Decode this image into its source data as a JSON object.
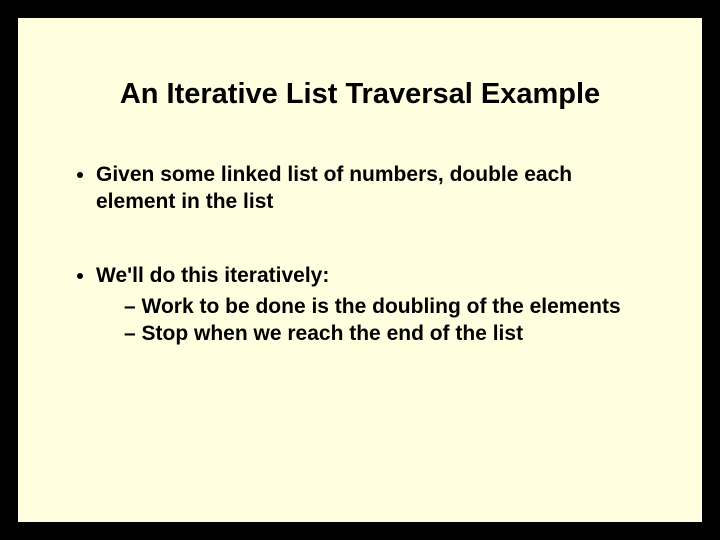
{
  "slide": {
    "title": "An Iterative List Traversal Example",
    "bullets": [
      {
        "text": "Given some linked list of numbers, double each element in the list"
      },
      {
        "text": "We'll do this iteratively:",
        "sub": [
          "Work to be done is the doubling of the elements",
          "Stop when we reach the end of the list"
        ]
      }
    ]
  }
}
